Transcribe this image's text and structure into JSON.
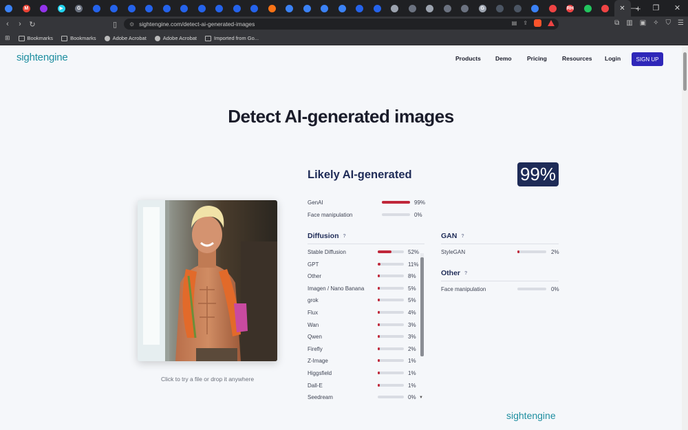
{
  "browser": {
    "url": "sightengine.com/detect-ai-generated-images",
    "bookmarks": [
      "Bookmarks",
      "Bookmarks",
      "Adobe Acrobat",
      "Adobe Acrobat",
      "Imported from Go..."
    ],
    "tab_favicons": [
      {
        "color": "#3b82f6",
        "glyph": ""
      },
      {
        "color": "#ea4335",
        "glyph": "M"
      },
      {
        "color": "#9333ea",
        "glyph": ""
      },
      {
        "color": "#22d3ee",
        "glyph": "▶"
      },
      {
        "color": "#6b7280",
        "glyph": "G"
      },
      {
        "color": "#2563eb",
        "glyph": ""
      },
      {
        "color": "#2563eb",
        "glyph": ""
      },
      {
        "color": "#2563eb",
        "glyph": ""
      },
      {
        "color": "#2563eb",
        "glyph": ""
      },
      {
        "color": "#2563eb",
        "glyph": ""
      },
      {
        "color": "#2563eb",
        "glyph": ""
      },
      {
        "color": "#2563eb",
        "glyph": ""
      },
      {
        "color": "#2563eb",
        "glyph": ""
      },
      {
        "color": "#2563eb",
        "glyph": ""
      },
      {
        "color": "#2563eb",
        "glyph": ""
      },
      {
        "color": "#f97316",
        "glyph": ""
      },
      {
        "color": "#3b82f6",
        "glyph": ""
      },
      {
        "color": "#3b82f6",
        "glyph": ""
      },
      {
        "color": "#3b82f6",
        "glyph": ""
      },
      {
        "color": "#3b82f6",
        "glyph": ""
      },
      {
        "color": "#2563eb",
        "glyph": ""
      },
      {
        "color": "#2563eb",
        "glyph": ""
      },
      {
        "color": "#9ca3af",
        "glyph": ""
      },
      {
        "color": "#6b7280",
        "glyph": ""
      },
      {
        "color": "#9ca3af",
        "glyph": ""
      },
      {
        "color": "#6b7280",
        "glyph": ""
      },
      {
        "color": "#6b7280",
        "glyph": ""
      },
      {
        "color": "#9ca3af",
        "glyph": "G"
      },
      {
        "color": "#4b5563",
        "glyph": ""
      },
      {
        "color": "#4b5563",
        "glyph": ""
      },
      {
        "color": "#3b82f6",
        "glyph": ""
      },
      {
        "color": "#ef4444",
        "glyph": ""
      },
      {
        "color": "#ef4444",
        "glyph": "RH"
      },
      {
        "color": "#22c55e",
        "glyph": ""
      },
      {
        "color": "#ef4444",
        "glyph": ""
      }
    ]
  },
  "site": {
    "logo": "sightengine",
    "nav": [
      "Products",
      "Demo",
      "Pricing",
      "Resources",
      "Login"
    ],
    "signup": "SIGN UP"
  },
  "hero_title": "Detect AI-generated images",
  "upload_caption": "Click to try a file or drop it anywhere",
  "result": {
    "verdict": "Likely AI-generated",
    "score": "99%",
    "accent": "#c0273a",
    "top": [
      {
        "label": "GenAI",
        "value": 0.99,
        "text": "99%"
      },
      {
        "label": "Face manipulation",
        "value": 0.0,
        "text": "0%"
      }
    ],
    "diffusion": {
      "title": "Diffusion",
      "help": "?",
      "items": [
        {
          "label": "Stable Diffusion",
          "value": 0.52,
          "text": "52%"
        },
        {
          "label": "GPT",
          "value": 0.11,
          "text": "11%"
        },
        {
          "label": "Other",
          "value": 0.08,
          "text": "8%"
        },
        {
          "label": "Imagen / Nano Banana",
          "value": 0.05,
          "text": "5%"
        },
        {
          "label": "grok",
          "value": 0.05,
          "text": "5%"
        },
        {
          "label": "Flux",
          "value": 0.04,
          "text": "4%"
        },
        {
          "label": "Wan",
          "value": 0.03,
          "text": "3%"
        },
        {
          "label": "Qwen",
          "value": 0.03,
          "text": "3%"
        },
        {
          "label": "Firefly",
          "value": 0.02,
          "text": "2%"
        },
        {
          "label": "Z-Image",
          "value": 0.01,
          "text": "1%"
        },
        {
          "label": "Higgsfield",
          "value": 0.01,
          "text": "1%"
        },
        {
          "label": "Dall-E",
          "value": 0.01,
          "text": "1%"
        },
        {
          "label": "Seedream",
          "value": 0.0,
          "text": "0%"
        }
      ]
    },
    "gan": {
      "title": "GAN",
      "help": "?",
      "items": [
        {
          "label": "StyleGAN",
          "value": 0.02,
          "text": "2%"
        }
      ]
    },
    "other": {
      "title": "Other",
      "help": "?",
      "items": [
        {
          "label": "Face manipulation",
          "value": 0.0,
          "text": "0%"
        }
      ]
    }
  },
  "footer_logo": "sightengine"
}
